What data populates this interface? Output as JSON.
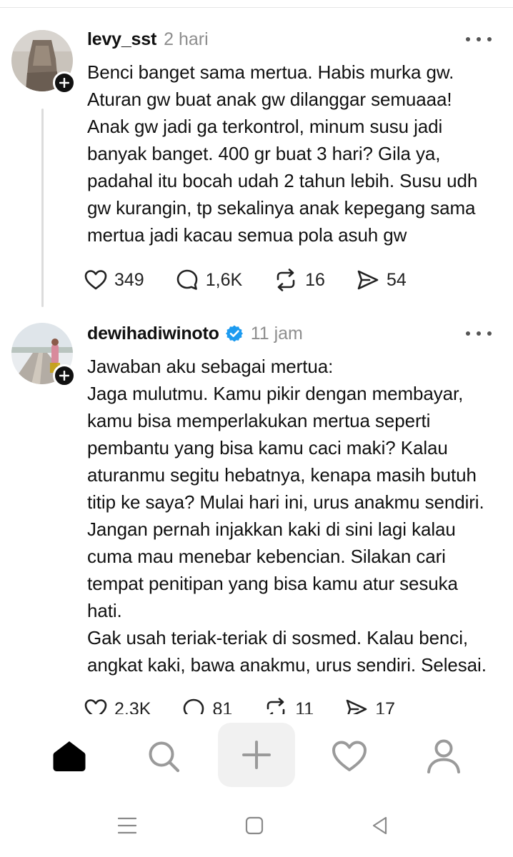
{
  "posts": [
    {
      "username": "levy_sst",
      "time": "2 hari",
      "verified": false,
      "text": "Benci banget sama mertua. Habis murka gw.\nAturan gw buat anak gw dilanggar semuaaa!\nAnak gw jadi ga terkontrol, minum susu jadi\nbanyak banget. 400 gr buat 3 hari? Gila ya,\npadahal itu bocah udah 2 tahun lebih. Susu udh\ngw kurangin, tp sekalinya anak kepegang sama\nmertua jadi kacau semua pola asuh gw",
      "likes": "349",
      "replies": "1,6K",
      "reposts": "16",
      "shares": "54"
    },
    {
      "username": "dewihadiwinoto",
      "time": "11 jam",
      "verified": true,
      "text": "Jawaban aku sebagai mertua:\nJaga mulutmu. Kamu pikir dengan membayar,\nkamu bisa memperlakukan mertua seperti\npembantu yang bisa kamu caci maki? Kalau\naturanmu segitu hebatnya, kenapa masih butuh\ntitip ke saya? Mulai hari ini, urus anakmu sendiri.\nJangan pernah injakkan kaki di sini lagi kalau\ncuma mau menebar kebencian. Silakan cari\ntempat penitipan yang bisa kamu atur sesuka\nhati.\nGak usah teriak-teriak di sosmed. Kalau benci,\nangkat kaki, bawa anakmu, urus sendiri. Selesai.",
      "likes": "2,3K",
      "replies": "81",
      "reposts": "11",
      "shares": "17"
    }
  ],
  "bottom_nav": [
    "home-icon",
    "search-icon",
    "create-icon",
    "activity-heart-icon",
    "profile-icon"
  ],
  "colors": {
    "text": "#111111",
    "muted": "#8e8e8e",
    "verified": "#1d9bf0",
    "nav_active": "#000000",
    "nav_inactive": "#9a9a9a"
  }
}
